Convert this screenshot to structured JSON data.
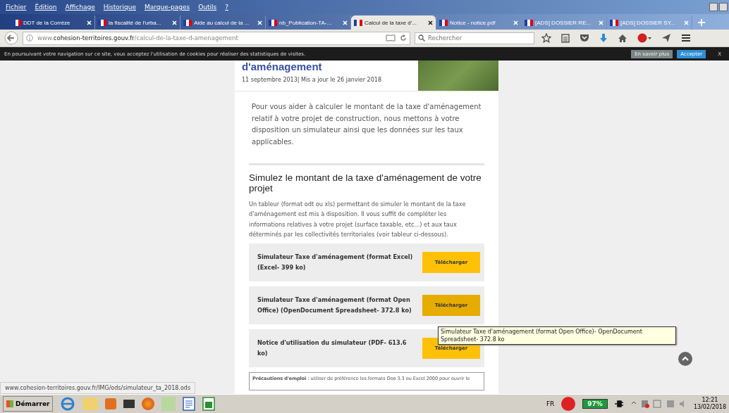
{
  "menu_bar": [
    "Fichier",
    "Édition",
    "Affichage",
    "Historique",
    "Marque-pages",
    "Outils",
    "?"
  ],
  "tabs": [
    {
      "label": "DDT de la Corrèze",
      "selected": false
    },
    {
      "label": "la fiscalité de l'urba...",
      "selected": false
    },
    {
      "label": "Aide au calcul de la ...",
      "selected": false
    },
    {
      "label": "nb_Publication-TA-...",
      "selected": false
    },
    {
      "label": "Calcul de la taxe d'...",
      "selected": true
    },
    {
      "label": "Notice - notice.pdf",
      "selected": false
    },
    {
      "label": "[ADS] DOSSIER RE...",
      "selected": false
    },
    {
      "label": "[ADS] DOSSIER SY...",
      "selected": false
    }
  ],
  "address": {
    "prefix": "www.",
    "domain": "cohesion-territoires.gouv.fr",
    "path": "/calcul-de-la-taxe-d-amenagement"
  },
  "search": {
    "placeholder": "Rechercher"
  },
  "cookie_bar": {
    "text": "En poursuivant votre navigation sur ce site, vous acceptez l'utilisation de cookies pour réaliser des statistiques de visites.",
    "more": "En savoir plus",
    "accept": "Accepter",
    "close": "X"
  },
  "article": {
    "title": "d'aménagement",
    "date": "11 septembre 2013| Mis a jour le 26 janvier 2018",
    "intro": "Pour vous aider à calculer le montant de la taxe d'aménagement relatif à votre projet de construction, nous mettons à votre disposition un simulateur ainsi que les données sur les taux applicables.",
    "section_title": "Simulez le montant de la taxe d'aménagement de votre projet",
    "section_text": "Un tableur (format odt ou xls) permettant de simuler le montant de la taxe d'aménagement est mis à disposition. Il vous suffit de compléter les informations relatives à votre projet (surface taxable, etc...) et aux taux déterminés par les collectivités territoriales (voir tableur ci-dessous).",
    "downloads": [
      {
        "label": "Simulateur Taxe d'aménagement (format Excel) (Excel- 399 ko)",
        "button": "Télécharger",
        "hovered": false
      },
      {
        "label": "Simulateur Taxe d'aménagement (format Open Office) (OpenDocument Spreadsheet- 372.8 ko)",
        "button": "Télécharger",
        "hovered": true
      },
      {
        "label": "Notice d'utilisation du simulateur (PDF- 613.6 ko)",
        "button": "Télécharger",
        "hovered": false
      }
    ],
    "precautions": "**Précautions d'emploi** : utiliser de préférence les formats Ooo 3.3 ou Excel 2000 pour ouvrir le"
  },
  "tooltip": "Simulateur Taxe d'aménagement (format Open Office)- OpenDocument Spreadsheet- 372.8 ko",
  "status_url": "www.cohesion-territoires.gouv.fr/IMG/ods/simulateur_ta_2018.ods",
  "taskbar": {
    "start": "Démarrer",
    "language": "FR",
    "battery": "97%",
    "time": "12:21",
    "date": "13/02/2018"
  }
}
